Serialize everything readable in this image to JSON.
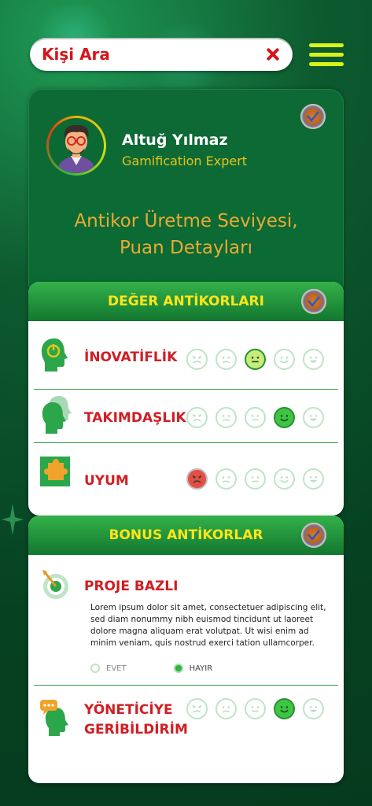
{
  "search": {
    "placeholder": "Kişi Ara"
  },
  "profile": {
    "name": "Altuğ Yılmaz",
    "role": "Gamification Expert",
    "level_title_line1": "Antikor Üretme Seviyesi,",
    "level_title_line2": "Puan Detayları"
  },
  "value_section": {
    "title": "DEĞER ANTİKORLARI",
    "rows": [
      {
        "label": "İNOVATİFLİK",
        "selected": 3,
        "selected_color": "#c7ec79"
      },
      {
        "label": "TAKIMDAŞLIK",
        "selected": 4,
        "selected_color": "#3ec543"
      },
      {
        "label": "UYUM",
        "selected": 1,
        "selected_color": "#e94b47"
      }
    ]
  },
  "bonus_section": {
    "title": "BONUS ANTİKORLAR",
    "project": {
      "label": "PROJE BAZLI",
      "description": "Lorem ipsum dolor sit amet, consectetuer adipiscing elit, sed diam nonummy nibh euismod tincidunt ut laoreet dolore magna aliquam erat volutpat. Ut wisi enim ad minim veniam, quis nostrud exerci tation ullamcorper.",
      "option_yes": "EVET",
      "option_no": "HAYIR",
      "selected": "HAYIR"
    },
    "feedback": {
      "label_line1": "YÖNETİCİYE",
      "label_line2": "GERİBİLDİRİM",
      "selected": 4,
      "selected_color": "#3ec543"
    }
  },
  "colors": {
    "accent_green": "#12772f",
    "title_yellow": "#ffe51a",
    "label_red": "#d01e24",
    "background": "#064222"
  }
}
